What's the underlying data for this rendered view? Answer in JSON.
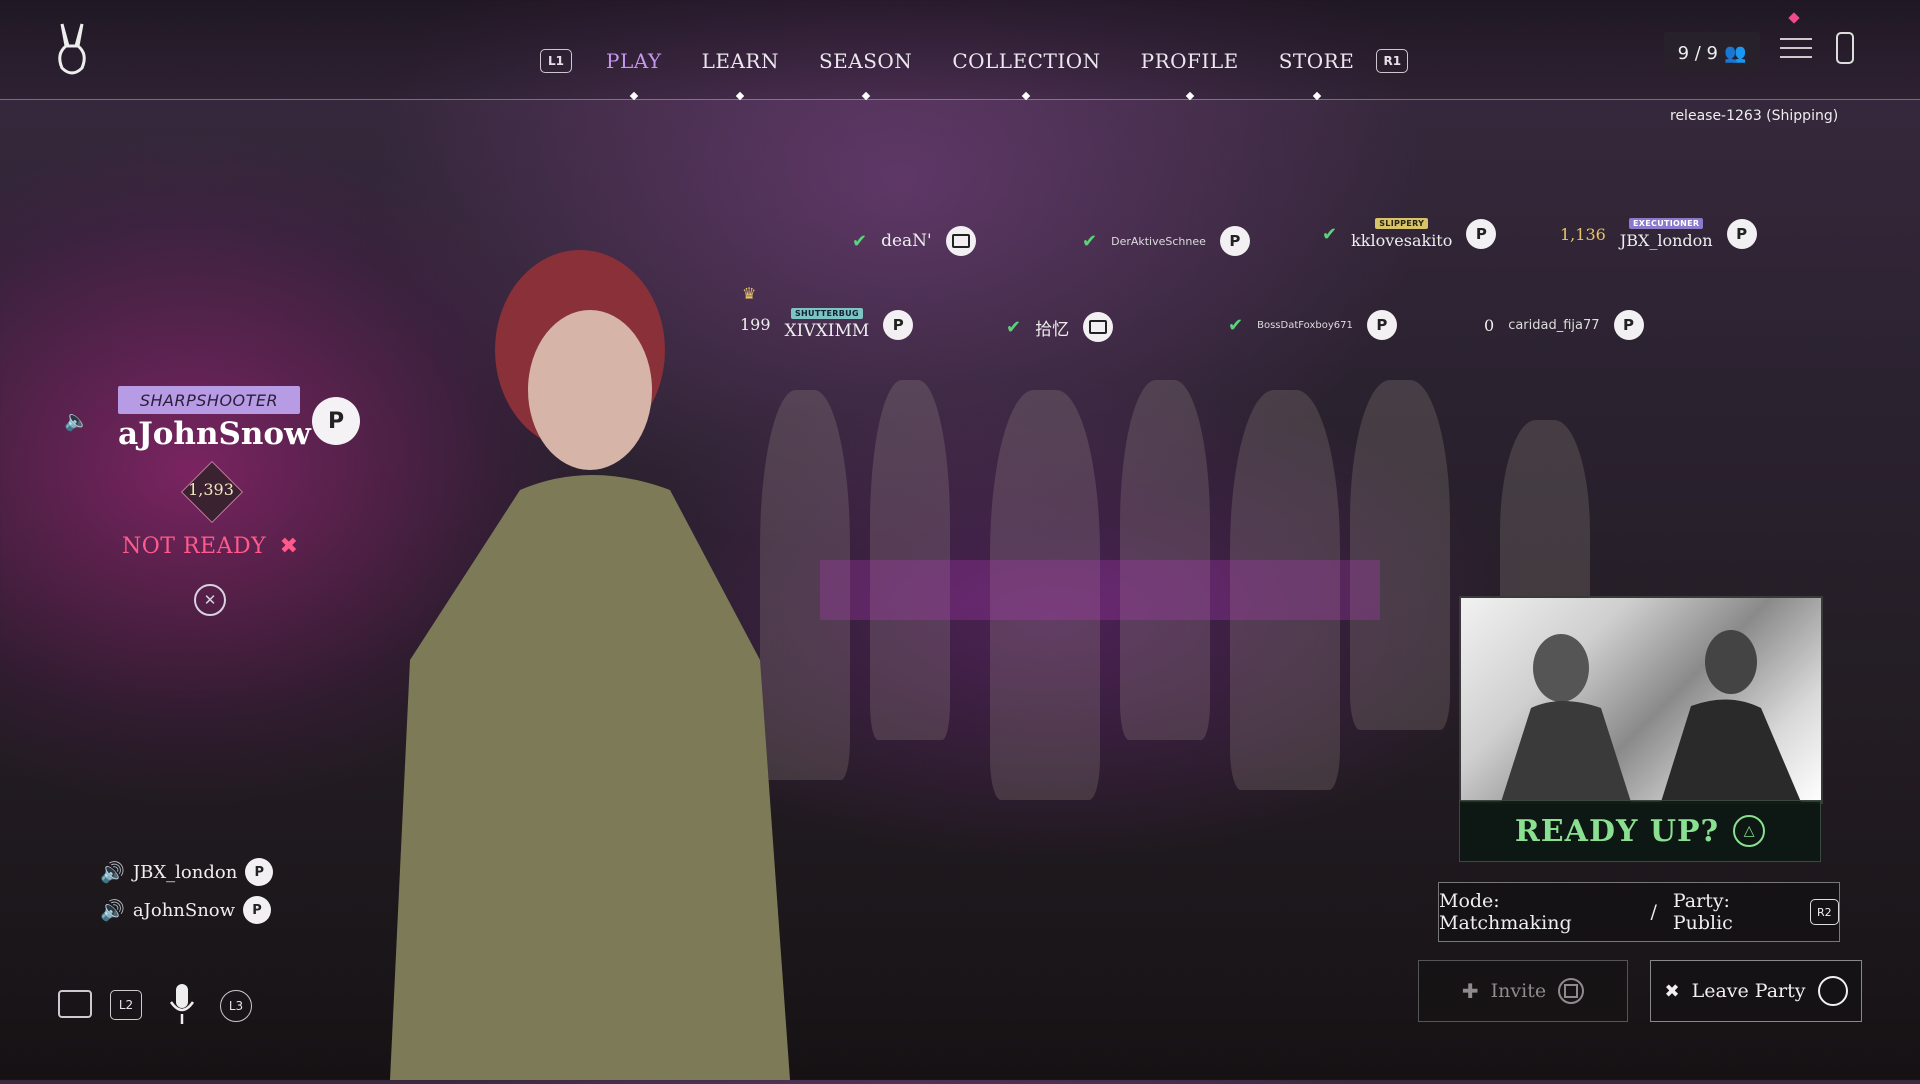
{
  "nav": {
    "left_button": "L1",
    "right_button": "R1",
    "items": [
      {
        "label": "PLAY",
        "active": true
      },
      {
        "label": "LEARN",
        "active": false
      },
      {
        "label": "SEASON",
        "active": false
      },
      {
        "label": "COLLECTION",
        "active": false
      },
      {
        "label": "PROFILE",
        "active": false
      },
      {
        "label": "STORE",
        "active": false
      }
    ]
  },
  "party_count": "9 / 9",
  "version": "release-1263 (Shipping)",
  "players_row1": [
    {
      "name": "deaN'",
      "platform": "tv-icon",
      "ready": true
    },
    {
      "name": "DerAktiveSchnee",
      "platform": "playstation-icon",
      "ready": true
    },
    {
      "name": "kklovesakito",
      "tag": "SLIPPERY",
      "platform": "playstation-icon",
      "ready": true
    },
    {
      "name": "JBX_london",
      "tag": "EXECUTIONER",
      "score": "1,136",
      "platform": "playstation-icon"
    }
  ],
  "players_row2": [
    {
      "name": "XIVXIMM",
      "tag": "SHUTTERBUG",
      "score": "199",
      "platform": "playstation-icon",
      "leader": true
    },
    {
      "name": "拾忆",
      "platform": "tv-icon",
      "ready": true
    },
    {
      "name": "BossDatFoxboy671",
      "platform": "playstation-icon",
      "ready": true
    },
    {
      "name": "caridad_fija77",
      "score": "0",
      "platform": "playstation-icon"
    }
  ],
  "local_player": {
    "title": "SHARPSHOOTER",
    "name": "aJohnSnow",
    "rank": "1,393",
    "status": "NOT READY"
  },
  "voice_chat": [
    {
      "name": "JBX_london"
    },
    {
      "name": "aJohnSnow"
    }
  ],
  "bottom_controls": {
    "chat": "chat-icon",
    "l2": "L2",
    "l3": "L3"
  },
  "ready_up": "READY UP?",
  "mode": {
    "label": "Mode: Matchmaking",
    "separator": "/",
    "party": "Party: Public",
    "button": "R2"
  },
  "invite_label": "Invite",
  "leave_label": "Leave Party",
  "colors": {
    "accent": "#c596f0",
    "ready": "#8ae090",
    "not_ready": "#ff5a8a",
    "check": "#5bd37a"
  }
}
